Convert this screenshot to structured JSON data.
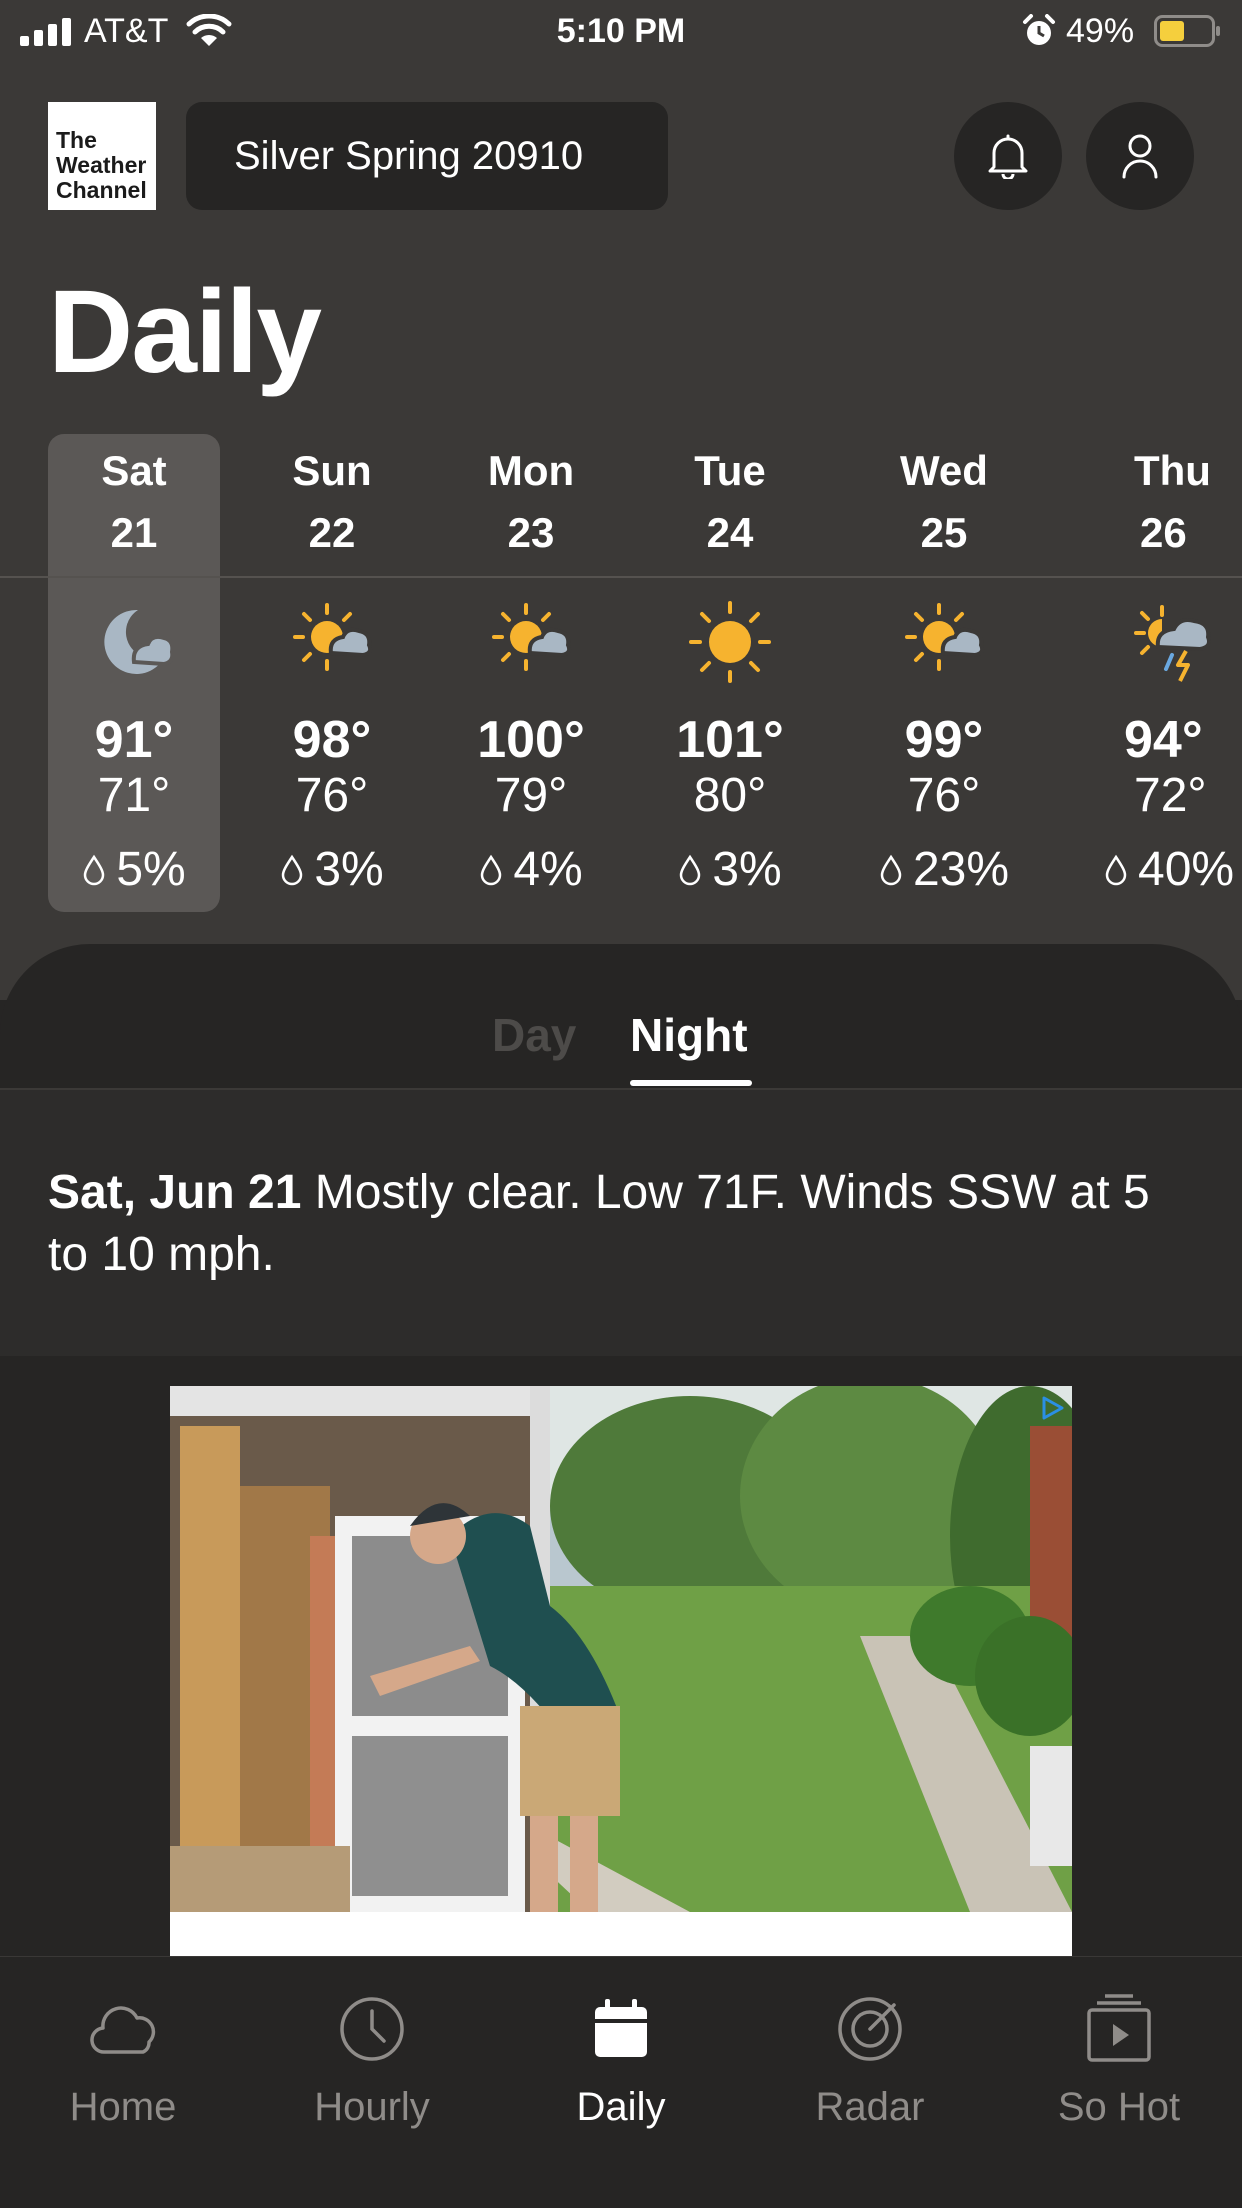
{
  "status_bar": {
    "carrier": "AT&T",
    "time": "5:10 PM",
    "battery": "49%"
  },
  "header": {
    "logo_lines": [
      "The",
      "Weather",
      "Channel"
    ],
    "location": "Silver Spring 20910"
  },
  "page_title": "Daily",
  "days": [
    {
      "name": "Sat",
      "date": "21",
      "icon": "moon-cloud-icon",
      "high": "91°",
      "low": "71°",
      "precip": "5%",
      "selected": true
    },
    {
      "name": "Sun",
      "date": "22",
      "icon": "partly-cloudy-icon",
      "high": "98°",
      "low": "76°",
      "precip": "3%"
    },
    {
      "name": "Mon",
      "date": "23",
      "icon": "partly-cloudy-icon",
      "high": "100°",
      "low": "79°",
      "precip": "4%"
    },
    {
      "name": "Tue",
      "date": "24",
      "icon": "sun-icon",
      "high": "101°",
      "low": "80°",
      "precip": "3%"
    },
    {
      "name": "Wed",
      "date": "25",
      "icon": "partly-cloudy-icon",
      "high": "99°",
      "low": "76°",
      "precip": "23%"
    },
    {
      "name": "Thu",
      "date": "26",
      "icon": "thunderstorm-icon",
      "high": "94°",
      "low": "72°",
      "precip": "40%"
    }
  ],
  "tabs": {
    "day": "Day",
    "night": "Night",
    "active": "Night"
  },
  "narrative": {
    "date": "Sat, Jun 21",
    "text": "Mostly clear. Low 71F. Winds SSW at 5 to 10 mph."
  },
  "ad": {
    "icon": "ad-choices-icon"
  },
  "tab_bar": [
    {
      "label": "Home",
      "icon": "cloud-icon"
    },
    {
      "label": "Hourly",
      "icon": "clock-icon"
    },
    {
      "label": "Daily",
      "icon": "calendar-icon",
      "active": true
    },
    {
      "label": "Radar",
      "icon": "radar-icon"
    },
    {
      "label": "So Hot",
      "icon": "video-icon"
    }
  ],
  "colors": {
    "header_bg": "#3b3937",
    "body_bg": "#262524",
    "selected_day_bg": "#5b5856",
    "sun": "#f6b32f",
    "cloud": "#a9b7c4"
  }
}
